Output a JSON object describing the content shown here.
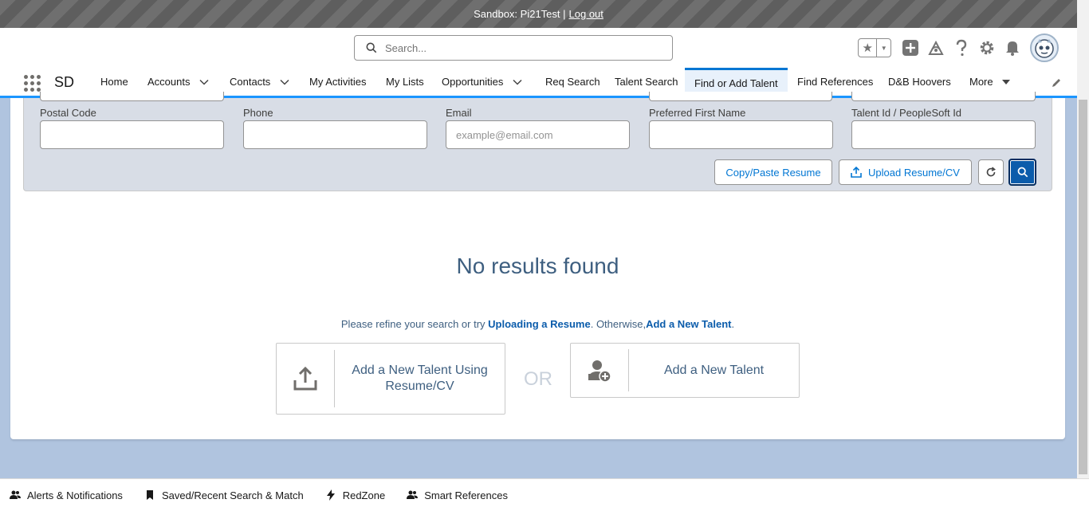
{
  "sandbox": {
    "prefix": "Sandbox: Pi21Test |",
    "logout": "Log out"
  },
  "header": {
    "search_placeholder": "Search..."
  },
  "nav": {
    "app_name": "SD",
    "items": [
      {
        "label": "Home"
      },
      {
        "label": "Accounts"
      },
      {
        "label": "Contacts"
      },
      {
        "label": "My Activities"
      },
      {
        "label": "My Lists"
      },
      {
        "label": "Opportunities"
      },
      {
        "label": "Req Search"
      },
      {
        "label": "Talent Search"
      },
      {
        "label": "Find or Add Talent"
      },
      {
        "label": "Find References"
      },
      {
        "label": "D&B Hoovers"
      },
      {
        "label": "More"
      }
    ],
    "active": "Find or Add Talent"
  },
  "filters": {
    "postal_code": {
      "label": "Postal Code",
      "value": ""
    },
    "phone": {
      "label": "Phone",
      "value": ""
    },
    "email": {
      "label": "Email",
      "placeholder": "example@email.com",
      "value": ""
    },
    "preferred_first_name": {
      "label": "Preferred First Name",
      "value": ""
    },
    "talent_id": {
      "label": "Talent Id / PeopleSoft Id",
      "value": ""
    }
  },
  "buttons": {
    "copy_paste": "Copy/Paste Resume",
    "upload": "Upload Resume/CV"
  },
  "results": {
    "title": "No results found",
    "hint_prefix": "Please refine your search or try ",
    "hint_link1": "Uploading a Resume",
    "hint_middle": ". Otherwise,",
    "hint_link2": "Add a New Talent",
    "hint_suffix": "."
  },
  "actions": {
    "add_with_resume": "Add a New Talent Using Resume/CV",
    "or": "OR",
    "add_new": "Add a New Talent"
  },
  "utility_bar": {
    "items": [
      {
        "label": "Alerts & Notifications"
      },
      {
        "label": "Saved/Recent Search & Match"
      },
      {
        "label": "RedZone"
      },
      {
        "label": "Smart References"
      }
    ]
  },
  "colors": {
    "brand": "#0176d3",
    "nav_active_bg": "#e8f1fb",
    "page_bg": "#b0c4df"
  }
}
